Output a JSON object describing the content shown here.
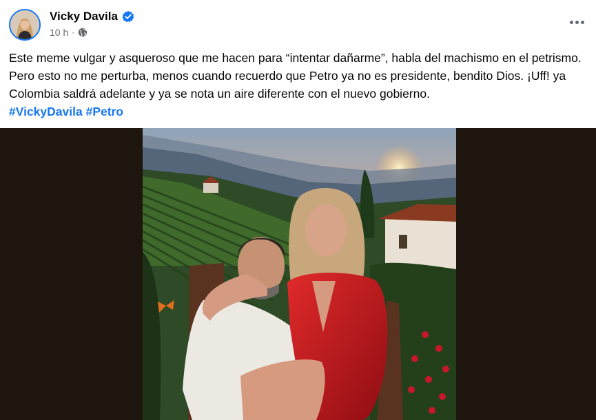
{
  "author": {
    "name": "Vicky Davila",
    "verified_icon": "verified-badge-icon"
  },
  "meta": {
    "time": "10 h",
    "separator": "·",
    "audience_icon": "globe-icon"
  },
  "post": {
    "text": "Este meme vulgar y asqueroso que me hacen para “intentar dañarme”, habla del machismo en el petrismo. Pero esto no me perturba, menos cuando recuerdo que Petro ya no es presidente, bendito Dios. ¡Uff! ya Colombia saldrá adelante y ya se nota un aire diferente con el nuevo gobierno.",
    "hashtags": [
      "#VickyDavila",
      "#Petro"
    ]
  },
  "colors": {
    "link": "#1877f2",
    "secondary_text": "#65676b",
    "media_background": "#1e150e"
  }
}
